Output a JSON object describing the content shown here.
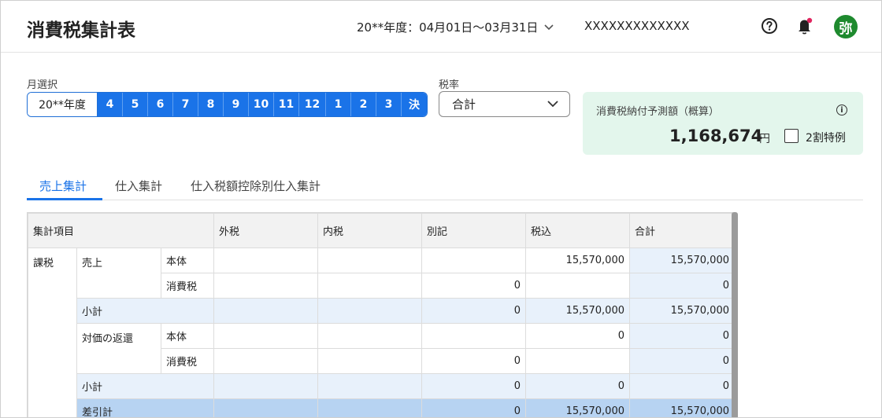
{
  "app": {
    "title": "消費税集計表",
    "period": "20**年度：04月01日〜03月31日",
    "company": "XXXXXXXXXXXXX",
    "avatar_label": "弥"
  },
  "icons": {
    "help": "help-circle-icon",
    "bell": "bell-icon",
    "period_chevron": "chevron-down-icon",
    "info": "info-icon"
  },
  "month_select": {
    "label": "月選択",
    "year": "20**年度",
    "months": [
      "4",
      "5",
      "6",
      "7",
      "8",
      "9",
      "10",
      "11",
      "12",
      "1",
      "2",
      "3",
      "決"
    ]
  },
  "tax_rate": {
    "label": "税率",
    "value": "合計"
  },
  "forecast": {
    "title": "消費税納付予測額（概算）",
    "amount": "1,168,674",
    "unit": "円",
    "checkbox_label": "2割特例",
    "checked": false
  },
  "tabs": [
    {
      "label": "売上集計",
      "active": true
    },
    {
      "label": "仕入集計",
      "active": false
    },
    {
      "label": "仕入税額控除別仕入集計",
      "active": false
    }
  ],
  "table": {
    "headers": [
      "集計項目",
      "外税",
      "内税",
      "別記",
      "税込",
      "合計"
    ],
    "rows": {
      "kazei": "課税",
      "uriage": "売上",
      "hontai": "本体",
      "shohizei": "消費税",
      "shokei": "小計",
      "henkan": "対価の返還",
      "sashihiki": "差引計",
      "r1": {
        "sotozei": "",
        "uchizei": "",
        "bekki": "",
        "zeikomi": "15,570,000",
        "total": "15,570,000"
      },
      "r2": {
        "sotozei": "",
        "uchizei": "",
        "bekki": "0",
        "zeikomi": "",
        "total": "0"
      },
      "r3": {
        "sotozei": "",
        "uchizei": "",
        "bekki": "0",
        "zeikomi": "15,570,000",
        "total": "15,570,000"
      },
      "r4": {
        "sotozei": "",
        "uchizei": "",
        "bekki": "",
        "zeikomi": "0",
        "total": "0"
      },
      "r5": {
        "sotozei": "",
        "uchizei": "",
        "bekki": "0",
        "zeikomi": "",
        "total": "0"
      },
      "r6": {
        "sotozei": "",
        "uchizei": "",
        "bekki": "0",
        "zeikomi": "0",
        "total": "0"
      },
      "r7": {
        "sotozei": "",
        "uchizei": "",
        "bekki": "0",
        "zeikomi": "15,570,000",
        "total": "15,570,000"
      }
    }
  },
  "colors": {
    "accent": "#1a73e8",
    "forecast_bg": "#e3f6ec",
    "avatar_bg": "#1e8a2e",
    "subtotal_bg": "#e8f1fb",
    "total_bg": "#b7d3f2"
  }
}
